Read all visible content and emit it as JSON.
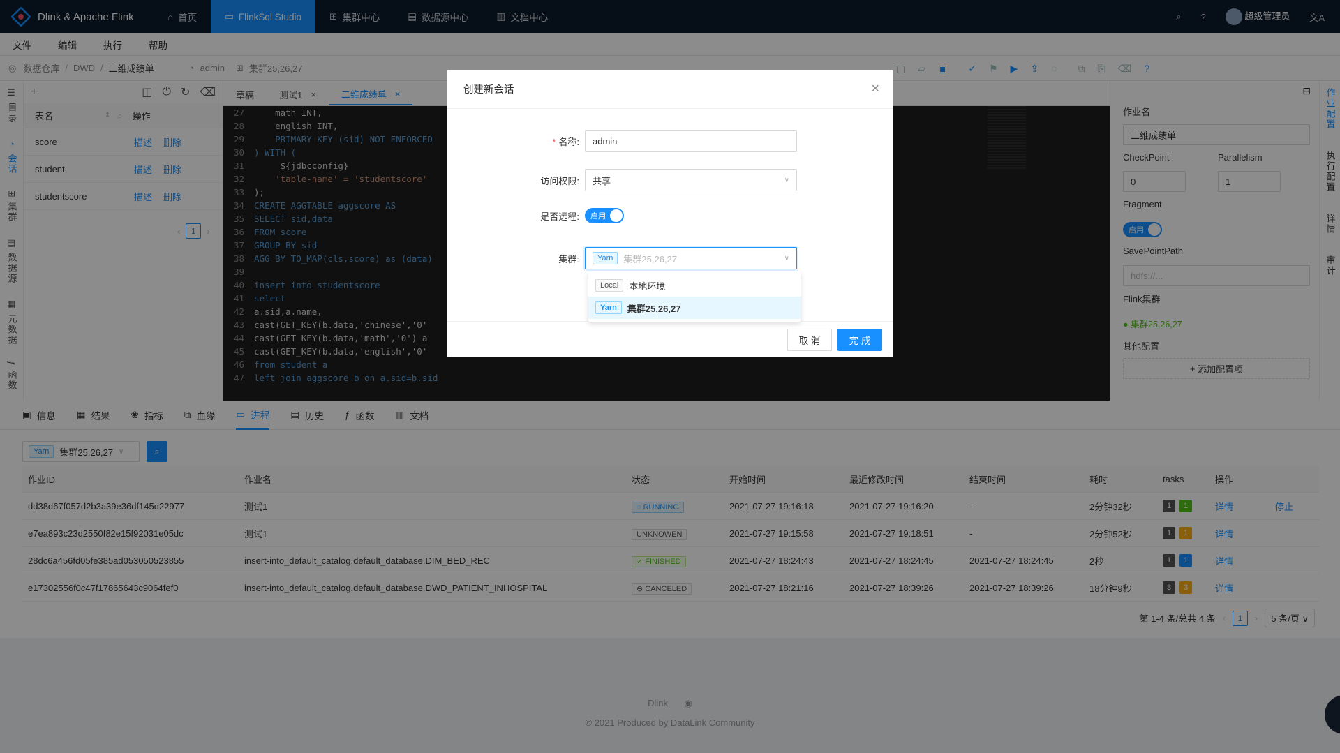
{
  "app": {
    "logo_text": "Dlink & Apache Flink"
  },
  "nav": [
    "首页",
    "FlinkSql Studio",
    "集群中心",
    "数据源中心",
    "文档中心"
  ],
  "user": {
    "name": "超级管理员"
  },
  "menu": [
    "文件",
    "编辑",
    "执行",
    "帮助"
  ],
  "breadcrumb": [
    "数据仓库",
    "DWD",
    "二维成绩单"
  ],
  "session_info": {
    "user": "admin",
    "cluster": "集群25,26,27"
  },
  "left_vtabs": [
    "目录",
    "会话",
    "集群",
    "数据源",
    "元数据",
    "函数"
  ],
  "table_panel": {
    "col_name": "表名",
    "col_op": "操作",
    "rows": [
      {
        "name": "score",
        "a": "描述",
        "b": "删除"
      },
      {
        "name": "student",
        "a": "描述",
        "b": "删除"
      },
      {
        "name": "studentscore",
        "a": "描述",
        "b": "删除"
      }
    ],
    "page": "1"
  },
  "editor_tabs": [
    "草稿",
    "测试1",
    "二维成绩单"
  ],
  "code_lines": [
    {
      "n": "27",
      "t": "    math INT,"
    },
    {
      "n": "28",
      "t": "    english INT,"
    },
    {
      "n": "29",
      "t": "    PRIMARY KEY (sid) NOT ENFORCED"
    },
    {
      "n": "30",
      "t": ") WITH ("
    },
    {
      "n": "31",
      "t": "     ${jdbcconfig}"
    },
    {
      "n": "32",
      "t": "    'table-name' = 'studentscore'"
    },
    {
      "n": "33",
      "t": ");"
    },
    {
      "n": "34",
      "t": "CREATE AGGTABLE aggscore AS"
    },
    {
      "n": "35",
      "t": "SELECT sid,data"
    },
    {
      "n": "36",
      "t": "FROM score"
    },
    {
      "n": "37",
      "t": "GROUP BY sid"
    },
    {
      "n": "38",
      "t": "AGG BY TO_MAP(cls,score) as (data)"
    },
    {
      "n": "39",
      "t": ""
    },
    {
      "n": "40",
      "t": "insert into studentscore"
    },
    {
      "n": "41",
      "t": "select"
    },
    {
      "n": "42",
      "t": "a.sid,a.name,"
    },
    {
      "n": "43",
      "t": "cast(GET_KEY(b.data,'chinese','0'"
    },
    {
      "n": "44",
      "t": "cast(GET_KEY(b.data,'math','0') a"
    },
    {
      "n": "45",
      "t": "cast(GET_KEY(b.data,'english','0'"
    },
    {
      "n": "46",
      "t": "from student a"
    },
    {
      "n": "47",
      "t": "left join aggscore b on a.sid=b.sid"
    }
  ],
  "right_panel": {
    "job_name_label": "作业名",
    "job_name": "二维成绩单",
    "checkpoint_label": "CheckPoint",
    "checkpoint": "0",
    "parallelism_label": "Parallelism",
    "parallelism": "1",
    "fragment_label": "Fragment",
    "fragment_switch": "启用",
    "savepoint_label": "SavePointPath",
    "savepoint_placeholder": "hdfs://...",
    "flink_cluster_label": "Flink集群",
    "flink_cluster": "集群25,26,27",
    "other_label": "其他配置",
    "add_config": "添加配置项"
  },
  "right_vtabs": [
    "作业配置",
    "执行配置",
    "详情",
    "审计"
  ],
  "bottom_tabs": [
    "信息",
    "结果",
    "指标",
    "血缘",
    "进程",
    "历史",
    "函数",
    "文档"
  ],
  "process": {
    "cluster_tag": "Yarn",
    "cluster": "集群25,26,27",
    "headers": [
      "作业ID",
      "作业名",
      "状态",
      "开始时间",
      "最近修改时间",
      "结束时间",
      "耗时",
      "tasks",
      "操作"
    ],
    "rows": [
      {
        "id": "dd38d67f057d2b3a39e36df145d22977",
        "name": "测试1",
        "status": "RUNNING",
        "start": "2021-07-27 19:16:18",
        "modified": "2021-07-27 19:16:20",
        "end": "-",
        "dur": "2分钟32秒",
        "t1": "1",
        "t2": "1",
        "t2color": "#52c41a",
        "op1": "详情",
        "op2": "停止"
      },
      {
        "id": "e7ea893c23d2550f82e15f92031e05dc",
        "name": "测试1",
        "status": "UNKNOWEN",
        "start": "2021-07-27 19:15:58",
        "modified": "2021-07-27 19:18:51",
        "end": "-",
        "dur": "2分钟52秒",
        "t1": "1",
        "t2": "1",
        "t2color": "#faad14",
        "op1": "详情",
        "op2": ""
      },
      {
        "id": "28dc6a456fd05fe385ad053050523855",
        "name": "insert-into_default_catalog.default_database.DIM_BED_REC",
        "status": "FINISHED",
        "start": "2021-07-27 18:24:43",
        "modified": "2021-07-27 18:24:45",
        "end": "2021-07-27 18:24:45",
        "dur": "2秒",
        "t1": "1",
        "t2": "1",
        "t2color": "#1890ff",
        "op1": "详情",
        "op2": ""
      },
      {
        "id": "e17302556f0c47f17865643c9064fef0",
        "name": "insert-into_default_catalog.default_database.DWD_PATIENT_INHOSPITAL",
        "status": "CANCELED",
        "start": "2021-07-27 18:21:16",
        "modified": "2021-07-27 18:39:26",
        "end": "2021-07-27 18:39:26",
        "dur": "18分钟9秒",
        "t1": "3",
        "t2": "3",
        "t2color": "#faad14",
        "op1": "详情",
        "op2": ""
      }
    ],
    "pager_text": "第 1-4 条/总共 4 条",
    "page": "1",
    "page_size": "5 条/页"
  },
  "footer": {
    "line1": "Dlink",
    "line2": "2021 Produced by DataLink Community"
  },
  "modal": {
    "title": "创建新会话",
    "name_label": "名称:",
    "name_value": "admin",
    "access_label": "访问权限:",
    "access_value": "共享",
    "remote_label": "是否远程:",
    "remote_switch": "启用",
    "cluster_label": "集群:",
    "cluster_tag": "Yarn",
    "cluster_value": "集群25,26,27",
    "options": [
      {
        "tag": "Local",
        "label": "本地环境"
      },
      {
        "tag": "Yarn",
        "label": "集群25,26,27"
      }
    ],
    "cancel": "取 消",
    "ok": "完 成"
  }
}
